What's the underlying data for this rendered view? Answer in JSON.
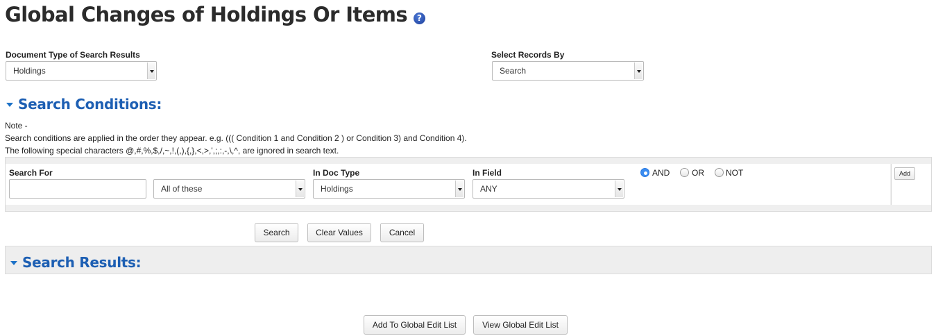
{
  "page": {
    "title": "Global Changes of Holdings Or Items",
    "help_icon": "question-mark-icon"
  },
  "document_type": {
    "label": "Document Type of Search Results",
    "value": "Holdings"
  },
  "select_records": {
    "label": "Select Records By",
    "value": "Search"
  },
  "search_conditions": {
    "heading": "Search Conditions:",
    "note_title": "Note -",
    "note_line1": "Search conditions are applied in the order they appear. e.g. ((( Condition 1 and Condition 2 ) or Condition 3) and Condition 4).",
    "note_line2": "The following special characters @,#,%,$,/,~,!,(,),{,},<,>,',;,:,-,\\,^, are ignored in search text.",
    "row": {
      "search_for_label": "Search For",
      "search_for_value": "",
      "match_value": "All of these",
      "in_doc_type_label": "In Doc Type",
      "in_doc_type_value": "Holdings",
      "in_field_label": "In Field",
      "in_field_value": "ANY",
      "operators": [
        {
          "label": "AND",
          "checked": true
        },
        {
          "label": "OR",
          "checked": false
        },
        {
          "label": "NOT",
          "checked": false
        }
      ],
      "add_label": "Add"
    },
    "buttons": {
      "search": "Search",
      "clear": "Clear Values",
      "cancel": "Cancel"
    }
  },
  "search_results": {
    "heading": "Search Results:"
  },
  "footer_buttons": {
    "add_to_list": "Add To Global Edit List",
    "view_list": "View Global Edit List"
  },
  "colors": {
    "heading_blue": "#1d5fb3",
    "radio_checked": "#3b8cf0"
  }
}
